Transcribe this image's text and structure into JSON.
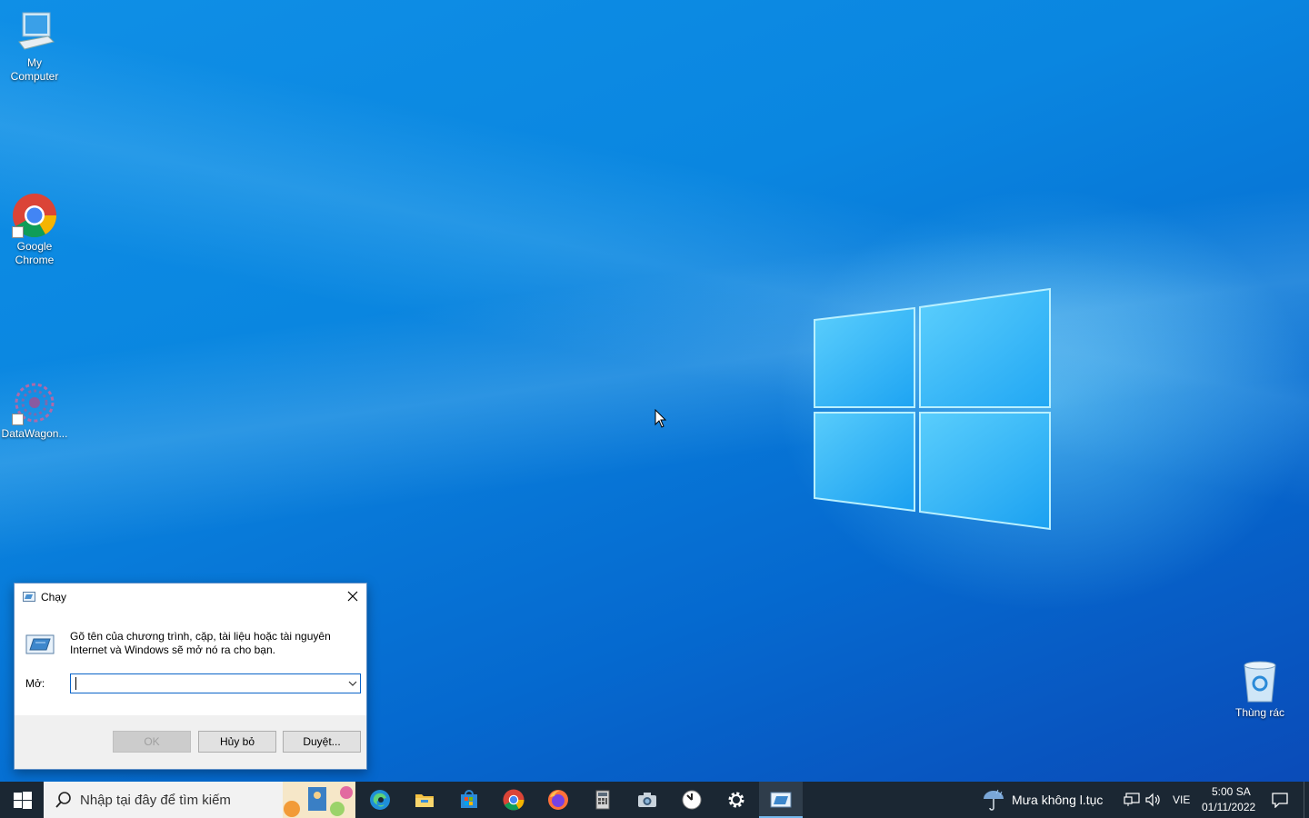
{
  "desktop": {
    "icons": [
      {
        "label_line1": "My",
        "label_line2": "Computer",
        "icon": "computer-icon"
      },
      {
        "label_line1": "Google",
        "label_line2": "Chrome",
        "icon": "chrome-icon"
      },
      {
        "label_line1": "DataWagon...",
        "label_line2": "",
        "icon": "datawagon-icon"
      }
    ],
    "recycle_bin": {
      "label": "Thùng rác",
      "icon": "recycle-bin-icon"
    }
  },
  "run_dialog": {
    "title": "Chạy",
    "description": "Gõ tên của chương trình, cặp, tài liệu hoặc tài nguyên Internet và Windows sẽ mở nó ra cho bạn.",
    "open_label": "Mở:",
    "open_value": "",
    "ok_label": "OK",
    "cancel_label": "Hủy bỏ",
    "browse_label": "Duyệt...",
    "accent": "#0a64c8"
  },
  "taskbar": {
    "search_placeholder": "Nhập tại đây để tìm kiếm",
    "apps": [
      {
        "name": "edge-icon"
      },
      {
        "name": "file-explorer-icon"
      },
      {
        "name": "store-icon"
      },
      {
        "name": "chrome-icon"
      },
      {
        "name": "firefox-icon"
      },
      {
        "name": "calculator-icon"
      },
      {
        "name": "camera-icon"
      },
      {
        "name": "clock-icon"
      },
      {
        "name": "settings-icon"
      },
      {
        "name": "run-icon",
        "active": true
      }
    ],
    "weather_text": "Mưa không l.tục",
    "language": "VIE",
    "time": "5:00 SA",
    "date": "01/11/2022",
    "background": "#1b2733"
  }
}
